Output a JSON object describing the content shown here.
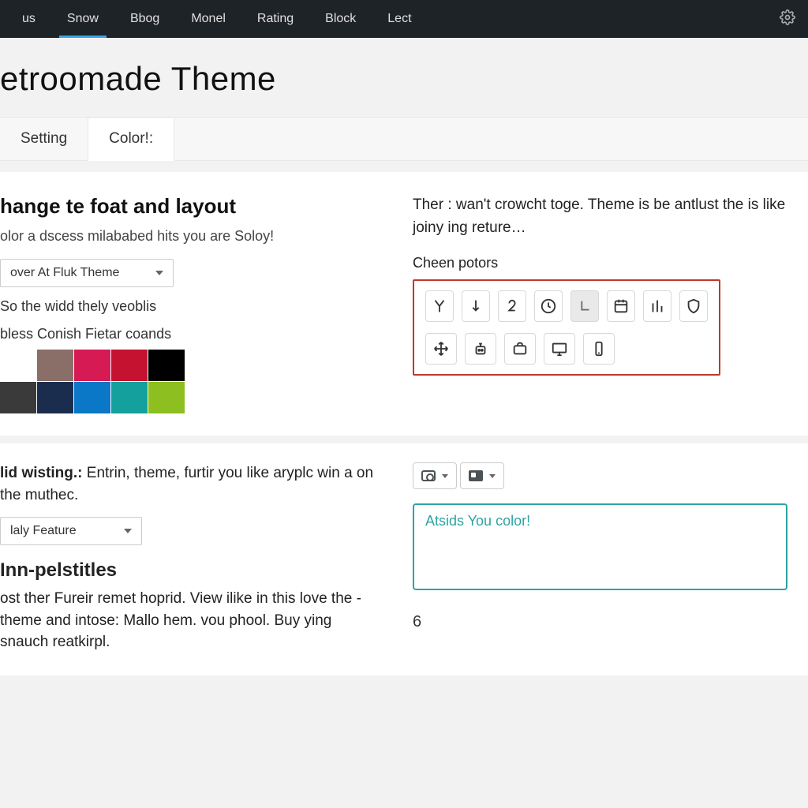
{
  "topnav": {
    "items": [
      "us",
      "Snow",
      "Bbog",
      "Monel",
      "Rating",
      "Block",
      "Lect"
    ],
    "active_index": 1
  },
  "page_title": "etroomade Theme",
  "tabs": {
    "items": [
      "Setting",
      "Color!:"
    ],
    "active_index": 1
  },
  "left": {
    "heading": "hange te foat and layout",
    "sub": "olor a dscess milababed hits you are Soloy!",
    "theme_select": "over At Fluk Theme",
    "line2": "So the widd thely veoblis",
    "swatch_label": "bless Conish Fietar coands",
    "colors": {
      "row1": [
        "#8a6f68",
        "#d61a54",
        "#c41230",
        "#000000"
      ],
      "row2": [
        "#3a3a3a",
        "#1a2d4e",
        "#0a77c7",
        "#14a09c",
        "#8cbf1f"
      ]
    }
  },
  "right": {
    "desc": "Ther : wan't crowcht toge. Theme is be antlust the is like joiny ing reture…",
    "label": "Cheen potors",
    "icons_row1": [
      "y-icon",
      "arrow-down-icon",
      "number-2-icon",
      "clock-icon",
      "l-shape-icon",
      "calendar-icon",
      "bars-icon",
      "shield-icon"
    ],
    "icons_row2": [
      "move-icon",
      "robot-icon",
      "briefcase-icon",
      "monitor-icon",
      "phone-icon"
    ],
    "selected_icon": "l-shape-icon"
  },
  "section2_left": {
    "lead_bold": "lid wisting.:",
    "lead_rest": " Entrin, theme, furtir you like aryplc win a on the muthec.",
    "feature_select": "laly Feature",
    "h3": "Inn-pelstitles",
    "body": "ost ther Fureir remet hoprid. View ilike in this love the -theme and intose: Mallo hem. vou phool. Buy ying snauch reatkirpl."
  },
  "section2_right": {
    "textarea_value": "Atsids You color!",
    "counter": "6"
  }
}
